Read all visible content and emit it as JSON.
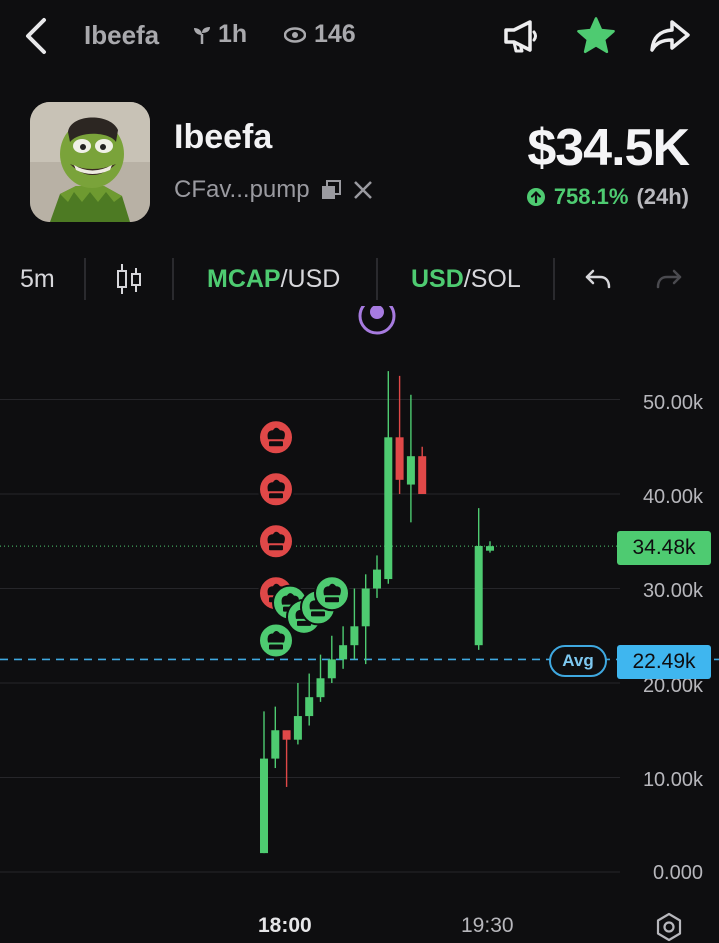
{
  "topbar": {
    "title": "Ibeefa",
    "age": "1h",
    "views": "146",
    "icons": [
      "back-icon",
      "sprout-icon",
      "eye-icon",
      "megaphone-icon",
      "star-icon",
      "share-icon"
    ]
  },
  "token": {
    "name": "Ibeefa",
    "address": "CFav...pump",
    "market_cap": "$34.5K",
    "change_pct": "758.1%",
    "change_period": "(24h)"
  },
  "toolbar": {
    "interval": "5m",
    "mcap_label": "MCAP",
    "mcap_pair_suffix": "/USD",
    "usd_label": "USD",
    "usd_pair_suffix": "/SOL"
  },
  "chart": {
    "y_ticks": [
      "50.00k",
      "40.00k",
      "30.00k",
      "20.00k",
      "10.00k",
      "0.000"
    ],
    "current_label": "34.48k",
    "avg_label": "Avg",
    "avg_value_label": "22.49k",
    "x_ticks": [
      "18:00",
      "19:30"
    ]
  },
  "chart_data": {
    "type": "candlestick",
    "y_unit": "market cap USD",
    "ylim": [
      0,
      55000
    ],
    "current": 34480,
    "average": 22490,
    "candles": [
      {
        "o": 2000,
        "h": 17000,
        "l": 2000,
        "c": 12000
      },
      {
        "o": 12000,
        "h": 17500,
        "l": 11000,
        "c": 15000
      },
      {
        "o": 15000,
        "h": 14500,
        "l": 9000,
        "c": 14000
      },
      {
        "o": 14000,
        "h": 20000,
        "l": 13500,
        "c": 16500
      },
      {
        "o": 16500,
        "h": 21000,
        "l": 15500,
        "c": 18500
      },
      {
        "o": 18500,
        "h": 23000,
        "l": 18000,
        "c": 20500
      },
      {
        "o": 20500,
        "h": 25000,
        "l": 20000,
        "c": 22500
      },
      {
        "o": 22500,
        "h": 26000,
        "l": 21500,
        "c": 24000
      },
      {
        "o": 24000,
        "h": 30000,
        "l": 22500,
        "c": 26000
      },
      {
        "o": 26000,
        "h": 31500,
        "l": 22000,
        "c": 30000
      },
      {
        "o": 30000,
        "h": 33500,
        "l": 29000,
        "c": 32000
      },
      {
        "o": 31000,
        "h": 53000,
        "l": 30500,
        "c": 46000
      },
      {
        "o": 46000,
        "h": 52500,
        "l": 40000,
        "c": 41500
      },
      {
        "o": 41000,
        "h": 50500,
        "l": 37000,
        "c": 44000
      },
      {
        "o": 44000,
        "h": 45000,
        "l": 40500,
        "c": 40000
      },
      {
        "o": 24000,
        "h": 38500,
        "l": 23500,
        "c": 34500
      },
      {
        "o": 34000,
        "h": 35000,
        "l": 33800,
        "c": 34480
      }
    ],
    "markers": [
      {
        "kind": "sell",
        "value": 46000,
        "candle": 1
      },
      {
        "kind": "sell",
        "value": 40500,
        "candle": 1
      },
      {
        "kind": "sell",
        "value": 35000,
        "candle": 1
      },
      {
        "kind": "sell",
        "value": 29500,
        "candle": 1
      },
      {
        "kind": "buy",
        "value": 24500,
        "candle": 1
      },
      {
        "kind": "buy",
        "value": 28500,
        "candle": 2
      },
      {
        "kind": "buy",
        "value": 27000,
        "candle": 3
      },
      {
        "kind": "buy",
        "value": 28000,
        "candle": 4
      },
      {
        "kind": "buy",
        "value": 29500,
        "candle": 5
      }
    ]
  },
  "colors": {
    "up": "#4ecb71",
    "down": "#e04848",
    "avg_line": "#3fa8e0",
    "avg_tag_bg": "#3fb6ef",
    "accent_purple": "#a77be0"
  }
}
